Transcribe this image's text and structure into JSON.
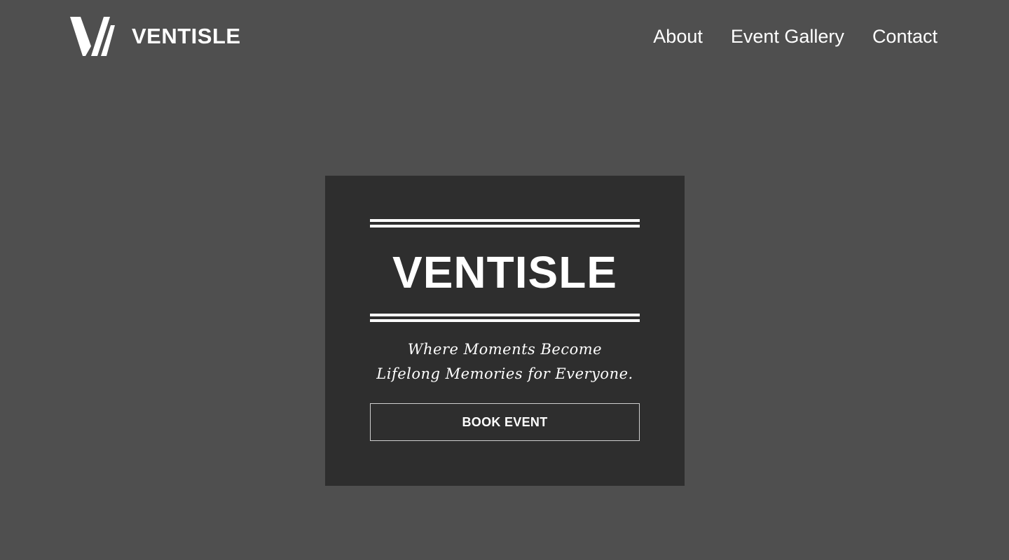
{
  "brand": {
    "name": "VENTISLE",
    "logo_icon": "ventisle-v-logo"
  },
  "nav": {
    "items": [
      {
        "label": "About"
      },
      {
        "label": "Event Gallery"
      },
      {
        "label": "Contact"
      }
    ]
  },
  "hero": {
    "title": "VENTISLE",
    "tagline": "Where Moments Become Lifelong Memories for Everyone.",
    "button_label": "BOOK EVENT"
  },
  "colors": {
    "page_background": "#4f4f4f",
    "card_background": "#2e2e2e",
    "text": "#ffffff"
  }
}
